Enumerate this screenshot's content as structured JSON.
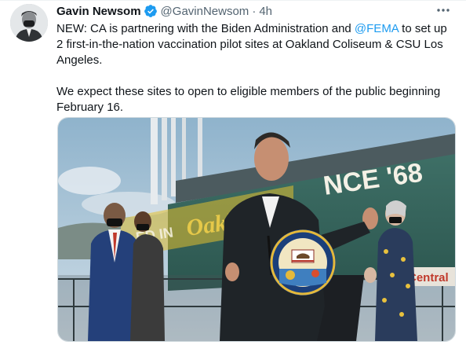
{
  "tweet": {
    "author": {
      "name": "Gavin Newsom",
      "handle": "@GavinNewsom",
      "separator": "·",
      "time": "4h",
      "verified_icon": "verified-badge-icon",
      "avatar": "avatar"
    },
    "text": {
      "p1_before": "NEW: CA is partnering with the Biden Administration and ",
      "p1_mention": "@FEMA",
      "p1_after": " to set up 2 first-in-the-nation vaccination pilot sites at Oakland Coliseum & CSU Los Angeles.",
      "p2": "We expect these sites to open to eligible members of the public beginning February 16."
    },
    "more_icon": "more-options-icon",
    "photo": {
      "stadium_sign": "NCE '68",
      "banner_text_left": "ED IN",
      "banner_text_oakland": "Oakl",
      "central_sign": "Central",
      "seal_outer_text": "GREAT SEAL OF THE STATE OF CALIFORNIA",
      "seal_motto": "EUREKA"
    },
    "colors": {
      "accent": "#1d9bf0",
      "text": "#0f1419",
      "secondary": "#536471"
    }
  }
}
